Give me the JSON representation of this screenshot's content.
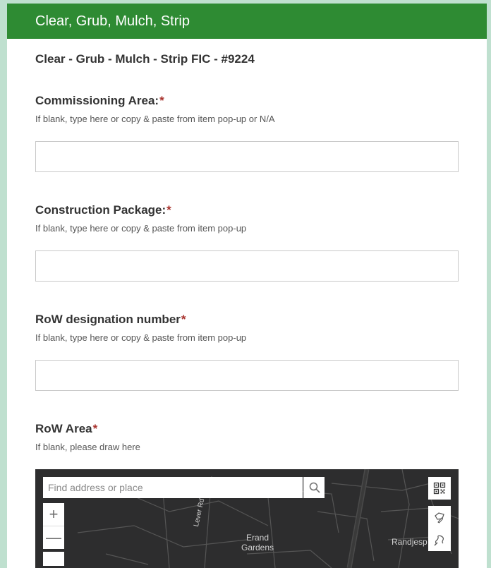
{
  "header": {
    "title": "Clear, Grub, Mulch, Strip"
  },
  "form": {
    "subtitle": "Clear - Grub - Mulch - Strip FIC - #9224"
  },
  "questions": [
    {
      "label": "Commissioning Area:",
      "required_mark": "*",
      "hint": "If blank, type here or copy & paste from item pop-up or N/A",
      "value": ""
    },
    {
      "label": "Construction Package:",
      "required_mark": "*",
      "hint": "If blank, type here or copy & paste from item pop-up",
      "value": ""
    },
    {
      "label": "RoW designation number",
      "required_mark": "*",
      "hint": "If blank, type here or copy & paste from item pop-up",
      "value": ""
    },
    {
      "label": "RoW Area",
      "required_mark": "*",
      "hint": "If blank, please draw here"
    }
  ],
  "map": {
    "search_placeholder": "Find address or place",
    "zoom_in": "+",
    "zoom_out": "—",
    "labels": {
      "road": "Lever Rd",
      "area_line1": "Erand",
      "area_line2": "Gardens",
      "place": "Randjesp"
    }
  },
  "colors": {
    "header_bg": "#2e8b33",
    "required": "#a8322d",
    "page_bg": "#bfe0cf",
    "map_bg": "#2d2d2e"
  }
}
